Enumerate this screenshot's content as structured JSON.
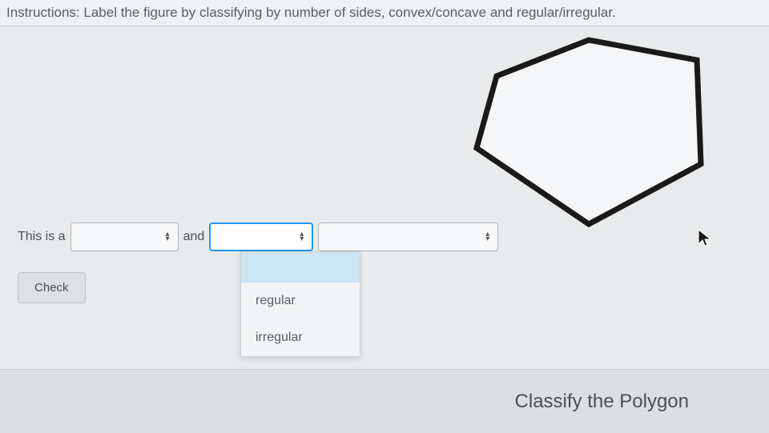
{
  "instructions": "Instructions: Label the figure by classifying by number of sides, convex/concave and regular/irregular.",
  "question": {
    "prefix": "This is a",
    "connector": "and"
  },
  "dropdown": {
    "options": [
      "",
      "regular",
      "irregular"
    ]
  },
  "buttons": {
    "check": "Check"
  },
  "footer": {
    "title": "Classify the Polygon"
  }
}
